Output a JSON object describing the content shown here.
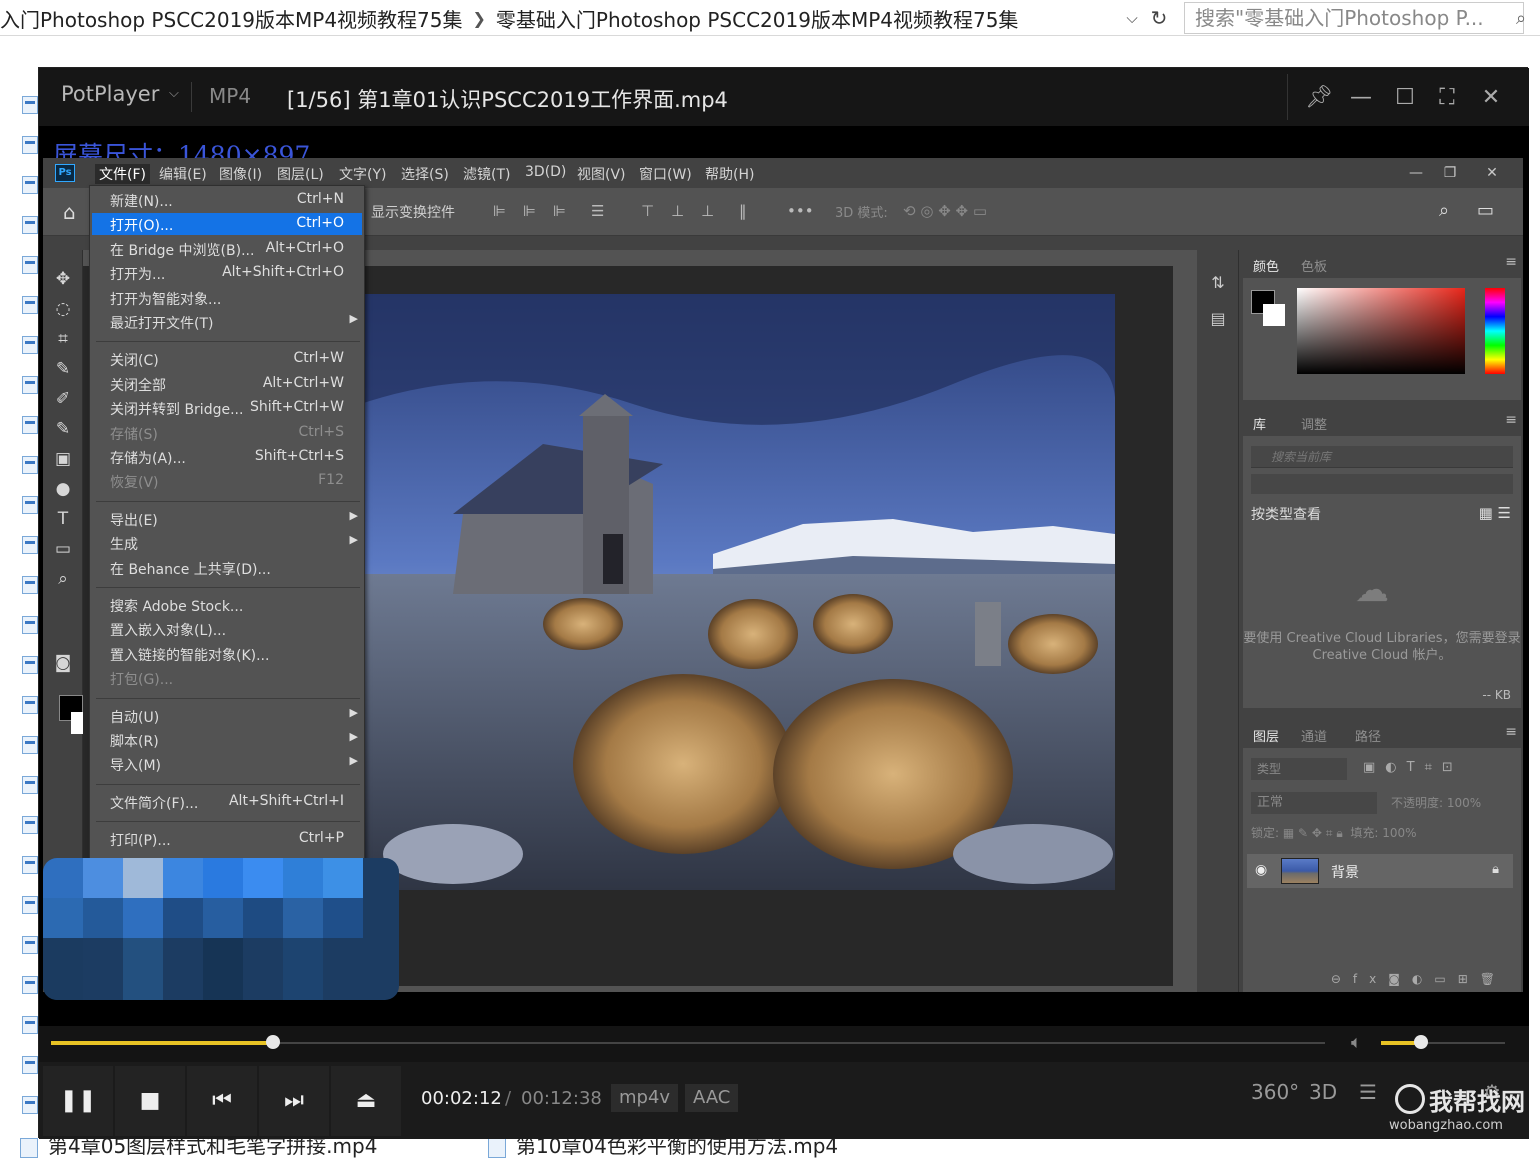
{
  "explorer": {
    "breadcrumb": [
      "入门Photoshop PSCC2019版本MP4视频教程75集",
      "零基础入门Photoshop PSCC2019版本MP4视频教程75集"
    ],
    "search_placeholder": "搜索\"零基础入门Photoshop P...",
    "bottom_files": [
      "第4章05图层样式和毛笔字拼接.mp4",
      "第10章04色彩平衡的使用方法.mp4"
    ]
  },
  "player": {
    "app_name": "PotPlayer",
    "format": "MP4",
    "title": "[1/56] 第1章01认识PSCC2019工作界面.mp4",
    "screen_size_label": "屏幕尺寸：1480×897",
    "time_current": "00:02:12",
    "time_separator": "/",
    "time_total": "00:12:38",
    "video_codec": "mp4v",
    "audio_codec": "AAC",
    "progress": 0.174,
    "volume": 0.32,
    "btn_360": "360°",
    "btn_3d": "3D",
    "watermark": "我帮找网",
    "watermark_url": "wobangzhao.com"
  },
  "photoshop": {
    "menus": [
      "文件(F)",
      "编辑(E)",
      "图像(I)",
      "图层(L)",
      "文字(Y)",
      "选择(S)",
      "滤镜(T)",
      "3D(D)",
      "视图(V)",
      "窗口(W)",
      "帮助(H)"
    ],
    "options_label": "显示变换控件",
    "options_3d": "3D 模式:",
    "file_menu": [
      {
        "label": "新建(N)...",
        "shortcut": "Ctrl+N"
      },
      {
        "label": "打开(O)...",
        "shortcut": "Ctrl+O",
        "highlighted": true
      },
      {
        "label": "在 Bridge 中浏览(B)...",
        "shortcut": "Alt+Ctrl+O"
      },
      {
        "label": "打开为...",
        "shortcut": "Alt+Shift+Ctrl+O"
      },
      {
        "label": "打开为智能对象...",
        "shortcut": ""
      },
      {
        "label": "最近打开文件(T)",
        "shortcut": "",
        "submenu": true
      },
      {
        "separator": true
      },
      {
        "label": "关闭(C)",
        "shortcut": "Ctrl+W"
      },
      {
        "label": "关闭全部",
        "shortcut": "Alt+Ctrl+W"
      },
      {
        "label": "关闭并转到 Bridge...",
        "shortcut": "Shift+Ctrl+W"
      },
      {
        "label": "存储(S)",
        "shortcut": "Ctrl+S",
        "disabled": true
      },
      {
        "label": "存储为(A)...",
        "shortcut": "Shift+Ctrl+S"
      },
      {
        "label": "恢复(V)",
        "shortcut": "F12",
        "disabled": true
      },
      {
        "separator": true
      },
      {
        "label": "导出(E)",
        "shortcut": "",
        "submenu": true
      },
      {
        "label": "生成",
        "shortcut": "",
        "submenu": true
      },
      {
        "label": "在 Behance 上共享(D)...",
        "shortcut": ""
      },
      {
        "separator": true
      },
      {
        "label": "搜索 Adobe Stock...",
        "shortcut": ""
      },
      {
        "label": "置入嵌入对象(L)...",
        "shortcut": ""
      },
      {
        "label": "置入链接的智能对象(K)...",
        "shortcut": ""
      },
      {
        "label": "打包(G)...",
        "shortcut": "",
        "disabled": true
      },
      {
        "separator": true
      },
      {
        "label": "自动(U)",
        "shortcut": "",
        "submenu": true
      },
      {
        "label": "脚本(R)",
        "shortcut": "",
        "submenu": true
      },
      {
        "label": "导入(M)",
        "shortcut": "",
        "submenu": true
      },
      {
        "separator": true
      },
      {
        "label": "文件简介(F)...",
        "shortcut": "Alt+Shift+Ctrl+I"
      },
      {
        "separator": true
      },
      {
        "label": "打印(P)...",
        "shortcut": "Ctrl+P"
      }
    ],
    "panels": {
      "color_tabs": [
        "颜色",
        "色板"
      ],
      "library_tabs": [
        "库",
        "调整"
      ],
      "library_search_placeholder": "搜索当前库",
      "library_view": "按类型查看",
      "library_message": "要使用 Creative Cloud Libraries，您需要登录 Creative Cloud 帐户。",
      "library_size": "-- KB",
      "layers_tabs": [
        "图层",
        "通道",
        "路径"
      ],
      "layers_filter": "类型",
      "blend_mode": "正常",
      "opacity_label": "不透明度:",
      "opacity_value": "100%",
      "lock_label": "锁定:",
      "fill_label": "填充:",
      "fill_value": "100%",
      "layer_name": "背景"
    }
  }
}
